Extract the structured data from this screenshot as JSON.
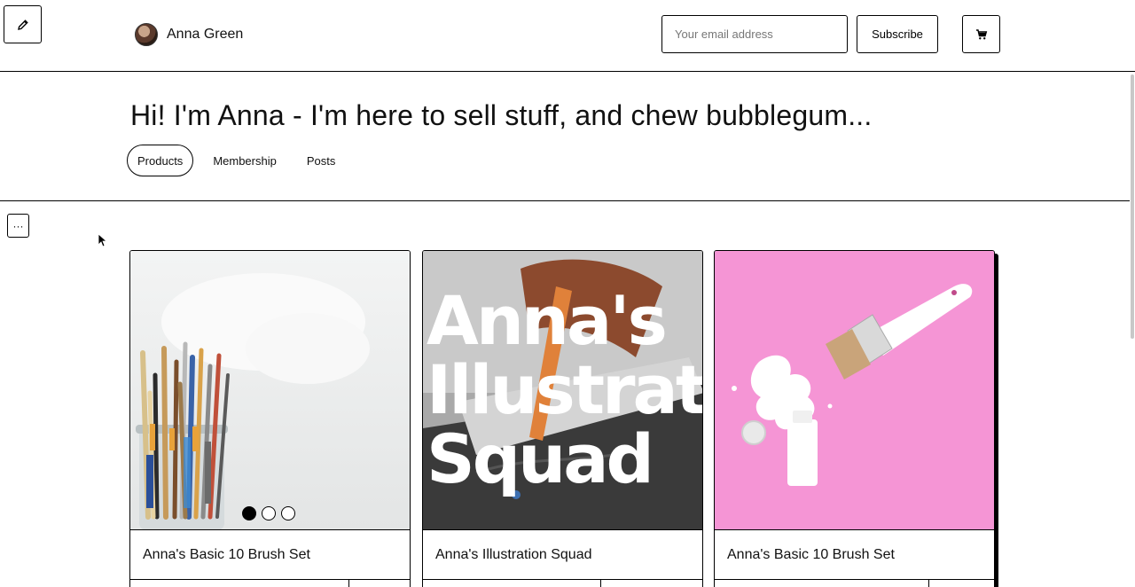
{
  "header": {
    "profile_name": "Anna Green",
    "email_placeholder": "Your email address",
    "subscribe_label": "Subscribe"
  },
  "hero": {
    "title": "Hi! I'm Anna - I'm here to sell stuff, and chew bubblegum..."
  },
  "tabs": [
    {
      "label": "Products",
      "active": true
    },
    {
      "label": "Membership",
      "active": false
    },
    {
      "label": "Posts",
      "active": false
    }
  ],
  "more_button_label": "···",
  "products": [
    {
      "title": "Anna's Basic 10 Brush Set",
      "carousel_total": 3,
      "carousel_active": 1
    },
    {
      "title": "Anna's Illustration Squad",
      "image_text": [
        "Anna's",
        "Illustratio",
        "Squad"
      ]
    },
    {
      "title": "Anna's Basic 10 Brush Set"
    }
  ],
  "icons": {
    "edit": "pencil-icon",
    "cart": "cart-icon",
    "more": "more-icon"
  },
  "colors": {
    "pink_background": "#f595d5",
    "border": "#000000"
  }
}
